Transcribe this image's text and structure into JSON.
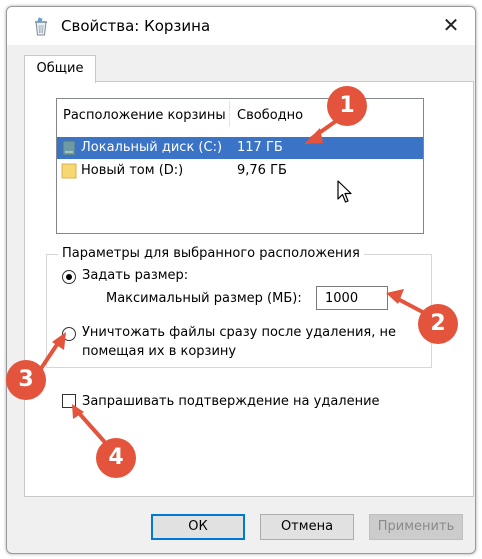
{
  "window": {
    "title": "Свойства: Корзина",
    "close_glyph": "✕"
  },
  "tabs": [
    {
      "label": "Общие",
      "active": true
    }
  ],
  "locations": {
    "columns": [
      "Расположение корзины",
      "Свободно"
    ],
    "rows": [
      {
        "name": "Локальный диск (C:)",
        "free": "117 ГБ",
        "selected": true,
        "icon": "drive-icon"
      },
      {
        "name": "Новый том (D:)",
        "free": "9,76 ГБ",
        "selected": false,
        "icon": "folder-drive-icon"
      }
    ]
  },
  "settings": {
    "group_title": "Параметры для выбранного расположения",
    "custom_size_label": "Задать размер:",
    "max_size_label": "Максимальный размер (МБ):",
    "max_size_value": "1000",
    "delete_immediately_line1": "Уничтожать файлы сразу после удаления, не",
    "delete_immediately_line2": "помещая их в корзину",
    "custom_size_selected": true,
    "confirm_delete_label": "Запрашивать подтверждение на удаление",
    "confirm_delete_checked": false
  },
  "buttons": {
    "ok": "ОК",
    "cancel": "Отмена",
    "apply": "Применить"
  },
  "annotations": {
    "badge_color": "#e4533b",
    "markers": [
      "1",
      "2",
      "3",
      "4"
    ]
  },
  "colors": {
    "selection": "#3b74c7",
    "default_button_border": "#0078d7",
    "window_bg": "#f0f0f0"
  }
}
